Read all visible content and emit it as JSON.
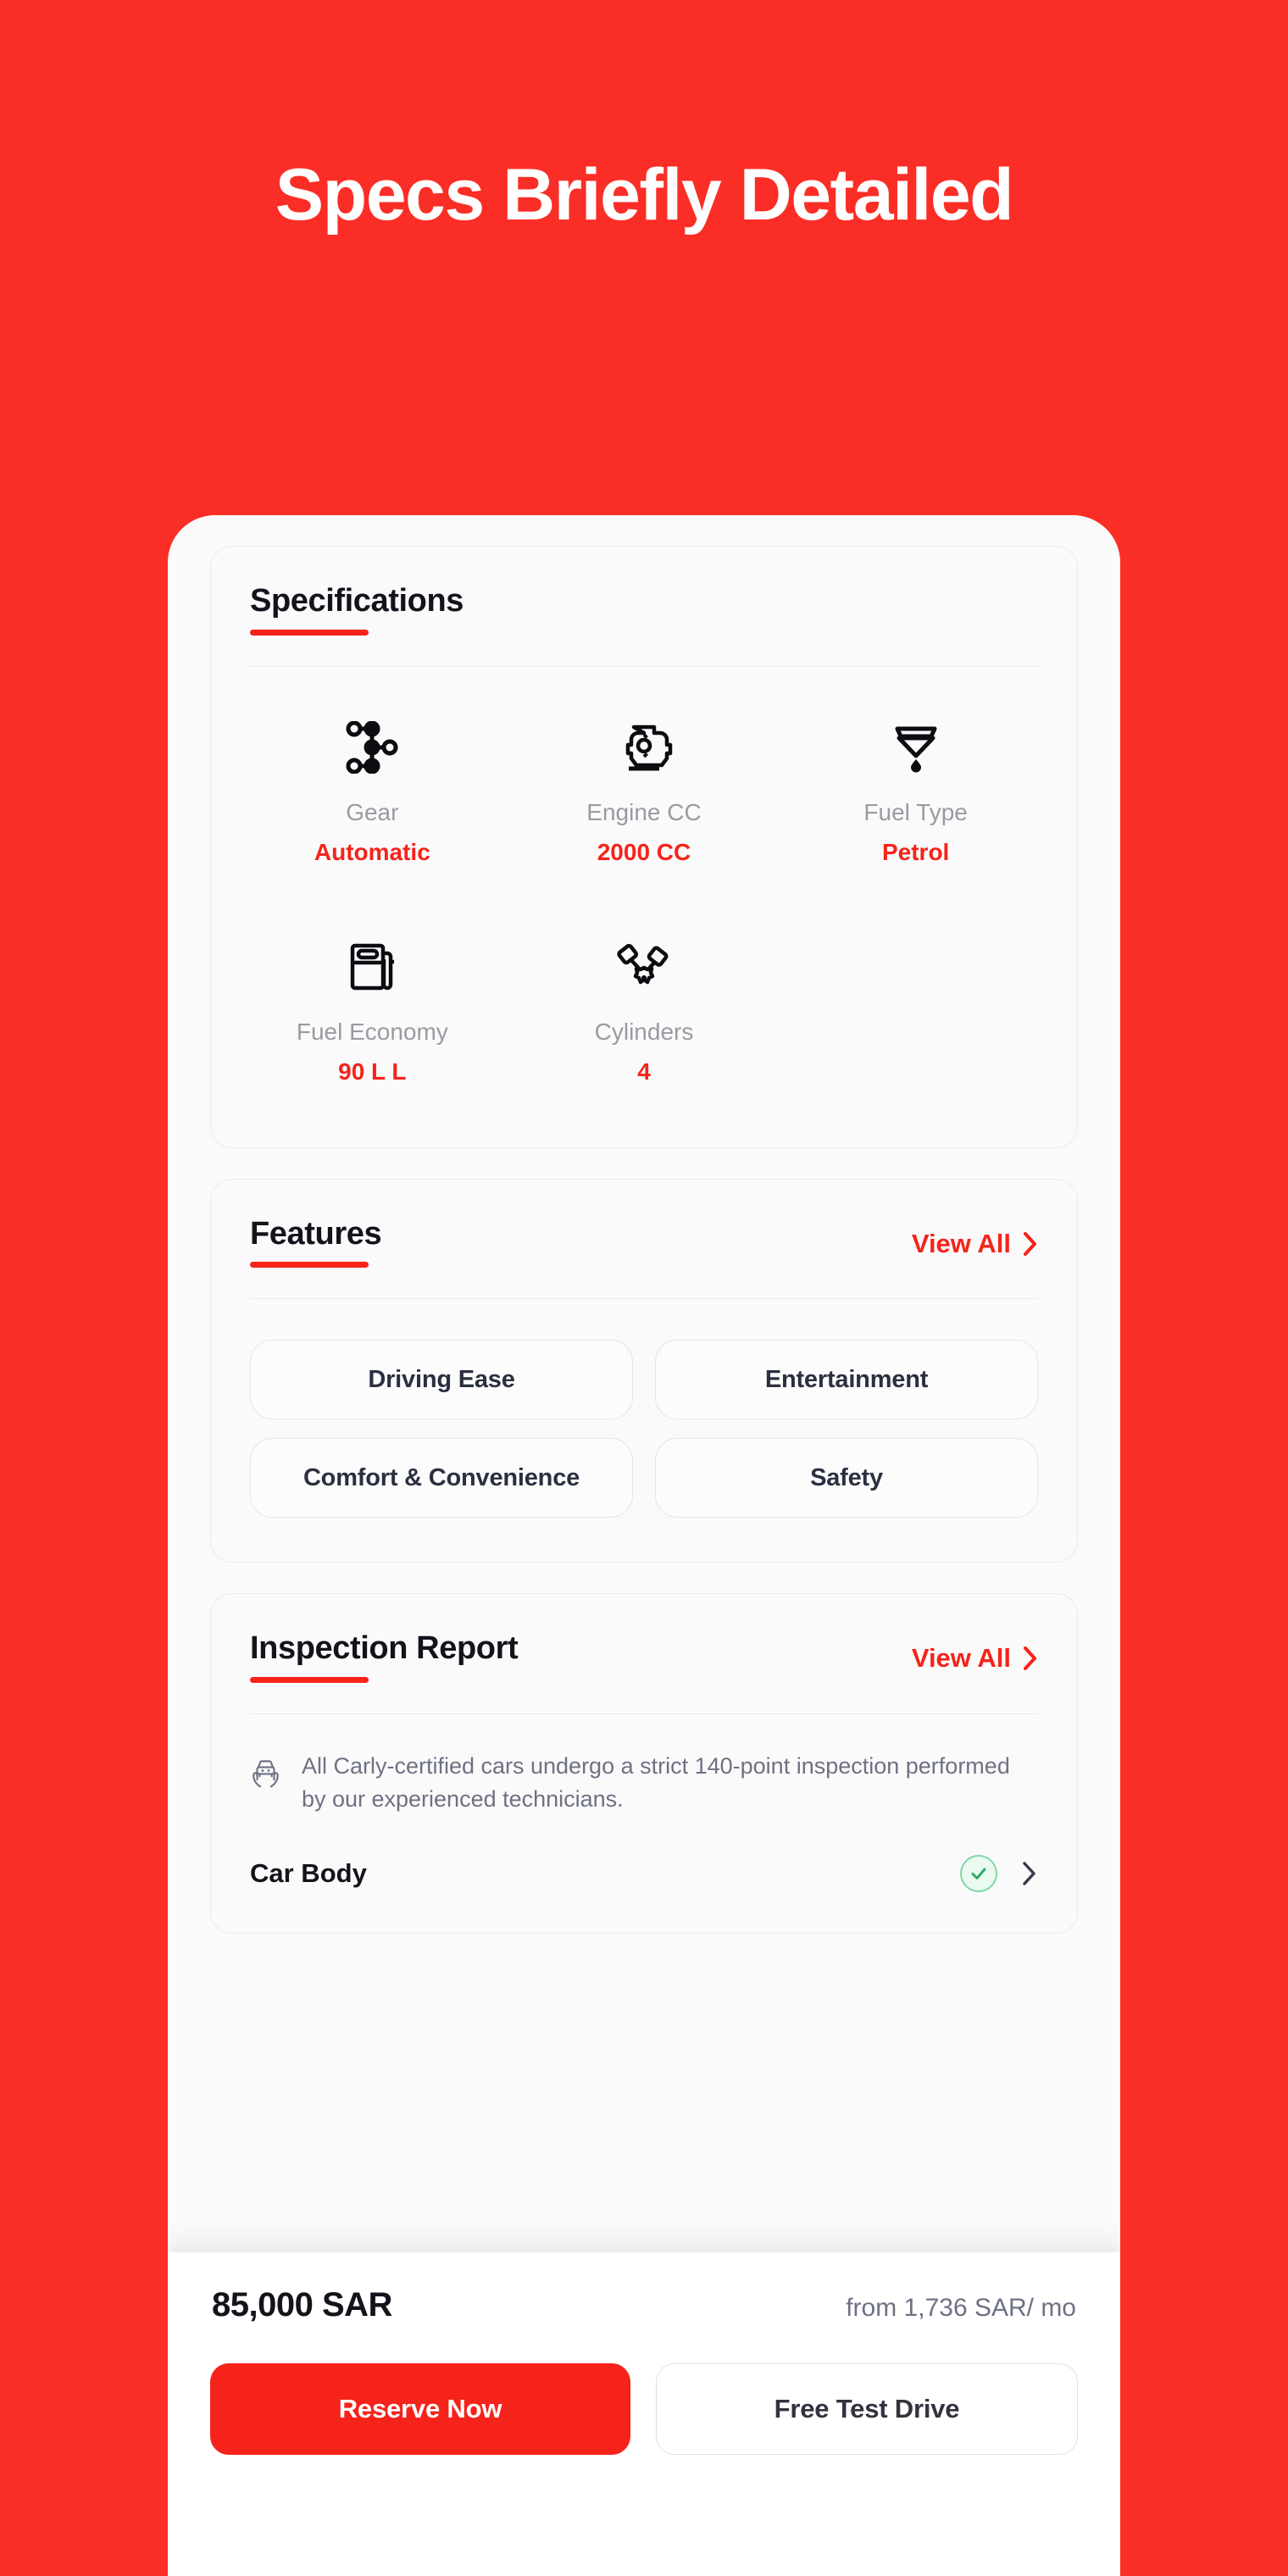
{
  "hero": {
    "headline": "Specs Briefly Detailed"
  },
  "colors": {
    "background": "#FA2E26",
    "accent": "#F5231A",
    "card_bg": "#FAFAFB",
    "text_dark": "#13141B",
    "text_muted": "#9A9AA2",
    "success": "#2FA96A"
  },
  "specifications": {
    "title": "Specifications",
    "items": [
      {
        "icon": "gear-shift-icon",
        "label": "Gear",
        "value": "Automatic"
      },
      {
        "icon": "engine-icon",
        "label": "Engine CC",
        "value": "2000 CC"
      },
      {
        "icon": "fuel-type-icon",
        "label": "Fuel Type",
        "value": "Petrol"
      },
      {
        "icon": "fuel-pump-icon",
        "label": "Fuel Economy",
        "value": "90 L L"
      },
      {
        "icon": "pistons-icon",
        "label": "Cylinders",
        "value": "4"
      }
    ]
  },
  "features": {
    "title": "Features",
    "view_all": "View All",
    "chips": [
      "Driving Ease",
      "Entertainment",
      "Comfort & Convenience",
      "Safety"
    ]
  },
  "inspection": {
    "title": "Inspection Report",
    "view_all": "View All",
    "note_icon": "car-in-hands-icon",
    "note": "All Carly-certified cars undergo a strict 140-point inspection performed by our experienced technicians.",
    "rows": [
      {
        "label": "Car Body",
        "status": "passed"
      }
    ]
  },
  "bottom_bar": {
    "price": "85,000 SAR",
    "financing": "from 1,736 SAR/ mo",
    "primary_button": "Reserve Now",
    "secondary_button": "Free Test Drive"
  }
}
